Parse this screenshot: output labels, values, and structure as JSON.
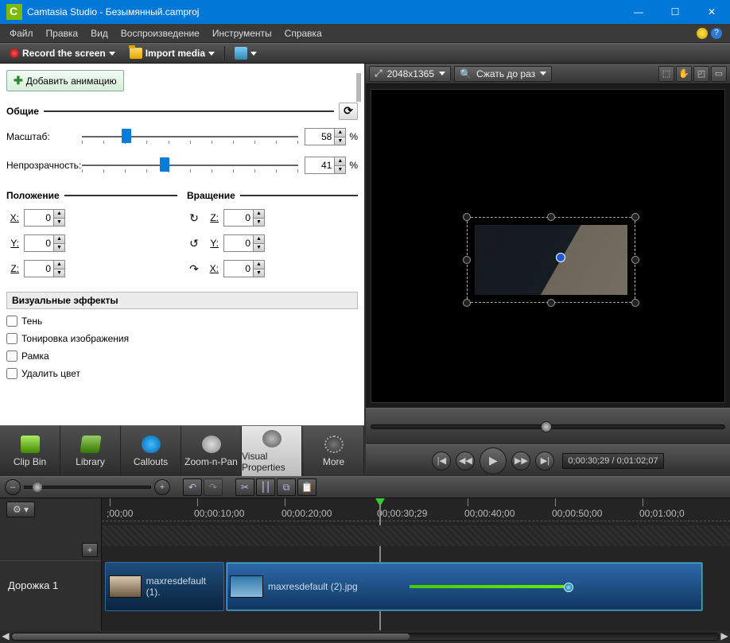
{
  "title": "Camtasia Studio - Безымянный.camproj",
  "menu": [
    "Файл",
    "Правка",
    "Вид",
    "Воспроизведение",
    "Инструменты",
    "Справка"
  ],
  "toolbar": {
    "record": "Record the screen",
    "import": "Import media"
  },
  "props": {
    "add_anim": "Добавить анимацию",
    "general": "Общие",
    "scale_label": "Масштаб:",
    "scale_value": "58",
    "opacity_label": "Непрозрачность:",
    "opacity_value": "41",
    "percent": "%",
    "position": "Положение",
    "rotation": "Вращение",
    "pos": {
      "x": "0",
      "y": "0",
      "z": "0"
    },
    "rot": {
      "z": "0",
      "y": "0",
      "x": "0"
    },
    "axis": {
      "x": "X:",
      "y": "Y:",
      "z": "Z:"
    },
    "effects_title": "Визуальные эффекты",
    "effects": [
      "Тень",
      "Тонировка изображения",
      "Рамка",
      "Удалить цвет"
    ]
  },
  "tabs": [
    "Clip Bin",
    "Library",
    "Callouts",
    "Zoom-n-Pan",
    "Visual Properties",
    "More"
  ],
  "preview": {
    "dimensions": "2048x1365",
    "shrink": "Сжать до раз",
    "time": "0;00:30;29 / 0;01:02;07"
  },
  "timeline": {
    "ticks": [
      ";00;00",
      "00;00:10;00",
      "00;00:20;00",
      "00;00:30;29",
      "00;00:40;00",
      "00;00:50;00",
      "00;01:00;0"
    ],
    "track_label": "Дорожка 1",
    "clips": [
      "maxresdefault (1).",
      "maxresdefault (2).jpg"
    ]
  }
}
